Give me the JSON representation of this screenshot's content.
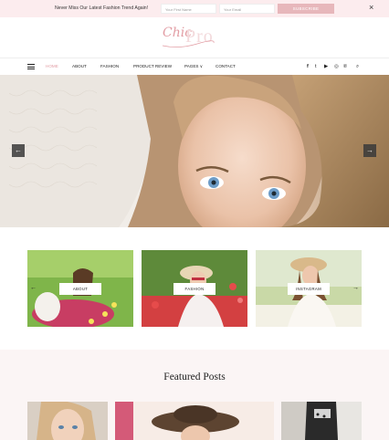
{
  "topbar": {
    "message": "Never Miss Our Latest Fashion Trend Again!",
    "first_name_placeholder": "Your First Name",
    "email_placeholder": "Your Email",
    "subscribe_label": "SUBSCRIBE",
    "close_icon": "×"
  },
  "brand": {
    "script": "Chic",
    "text": "Pro",
    "accent": "#e29ca3"
  },
  "nav": {
    "menu_icon": "hamburger-icon",
    "items": [
      {
        "label": "HOME",
        "active": true
      },
      {
        "label": "ABOUT",
        "active": false
      },
      {
        "label": "FASHION",
        "active": false
      },
      {
        "label": "PRODUCT REVIEW",
        "active": false
      },
      {
        "label": "PAGES ∨",
        "active": false
      },
      {
        "label": "CONTACT",
        "active": false
      }
    ],
    "social": [
      "f",
      "t",
      "▶",
      "◎",
      "℗",
      "⌕"
    ]
  },
  "hero": {
    "prev_icon": "←",
    "next_icon": "→"
  },
  "categories": {
    "items": [
      {
        "label": "ABOUT"
      },
      {
        "label": "FASHION"
      },
      {
        "label": "INSTAGRAM"
      }
    ],
    "prev_icon": "←",
    "next_icon": "→"
  },
  "featured": {
    "title": "Featured Posts"
  }
}
